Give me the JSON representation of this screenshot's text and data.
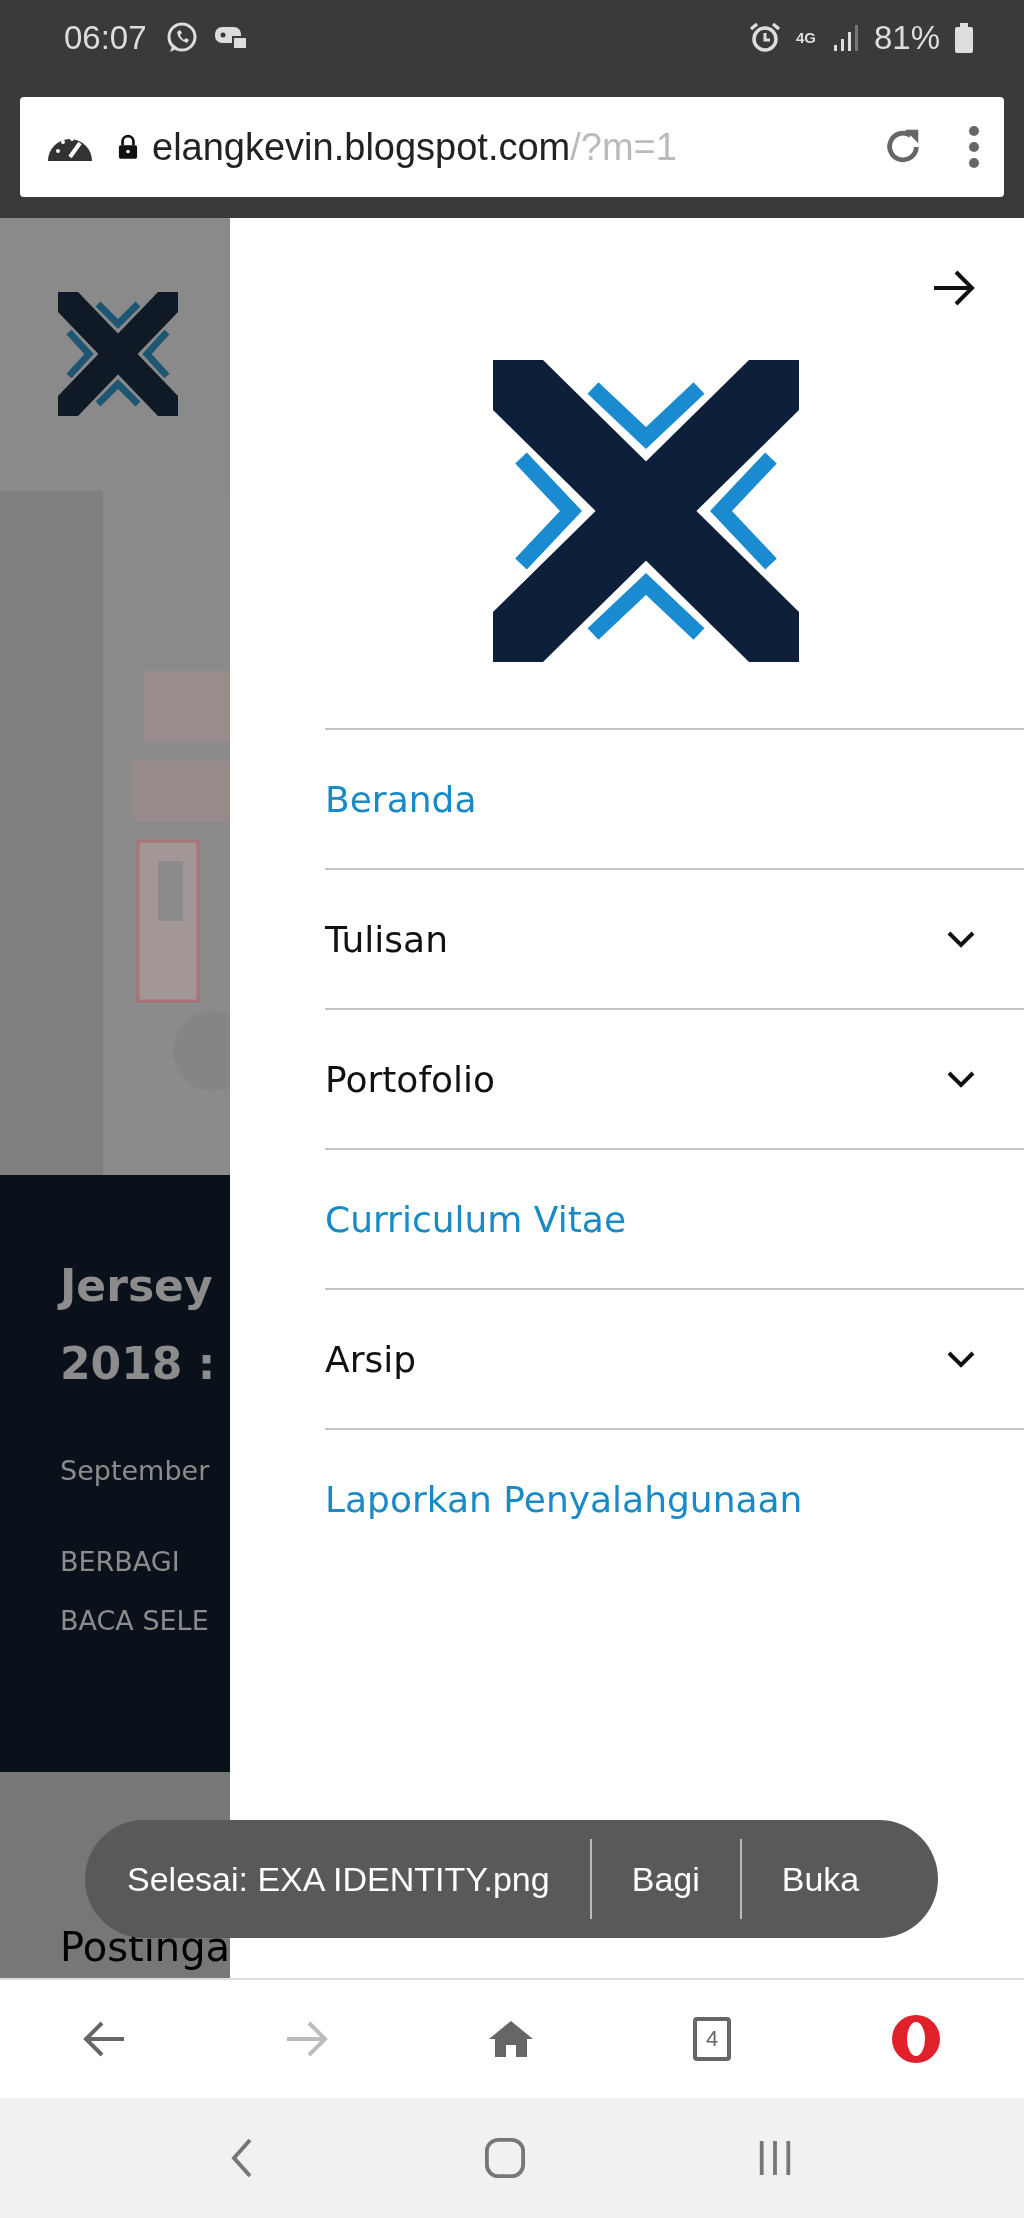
{
  "status_bar": {
    "time": "06:07",
    "network": "4G",
    "battery": "81%"
  },
  "address_bar": {
    "domain": "elangkevin.blogspot.com",
    "path": "/?m=1"
  },
  "page": {
    "title_lines": [
      "Jersey",
      "2018 :"
    ],
    "date": "September",
    "actions": [
      "BERBAGI",
      "BACA SELE"
    ],
    "section": "Postinga"
  },
  "drawer": {
    "items": [
      {
        "label": "Beranda",
        "kind": "link"
      },
      {
        "label": "Tulisan",
        "kind": "submenu"
      },
      {
        "label": "Portofolio",
        "kind": "submenu"
      },
      {
        "label": "Curriculum Vitae",
        "kind": "link"
      },
      {
        "label": "Arsip",
        "kind": "submenu"
      },
      {
        "label": "Laporkan Penyalahgunaan",
        "kind": "link"
      }
    ]
  },
  "snackbar": {
    "message": "Selesai: EXA IDENTITY.png",
    "actions": [
      "Bagi",
      "Buka"
    ]
  },
  "bottom_nav": {
    "forward_disabled": true,
    "tab_count": "4"
  }
}
